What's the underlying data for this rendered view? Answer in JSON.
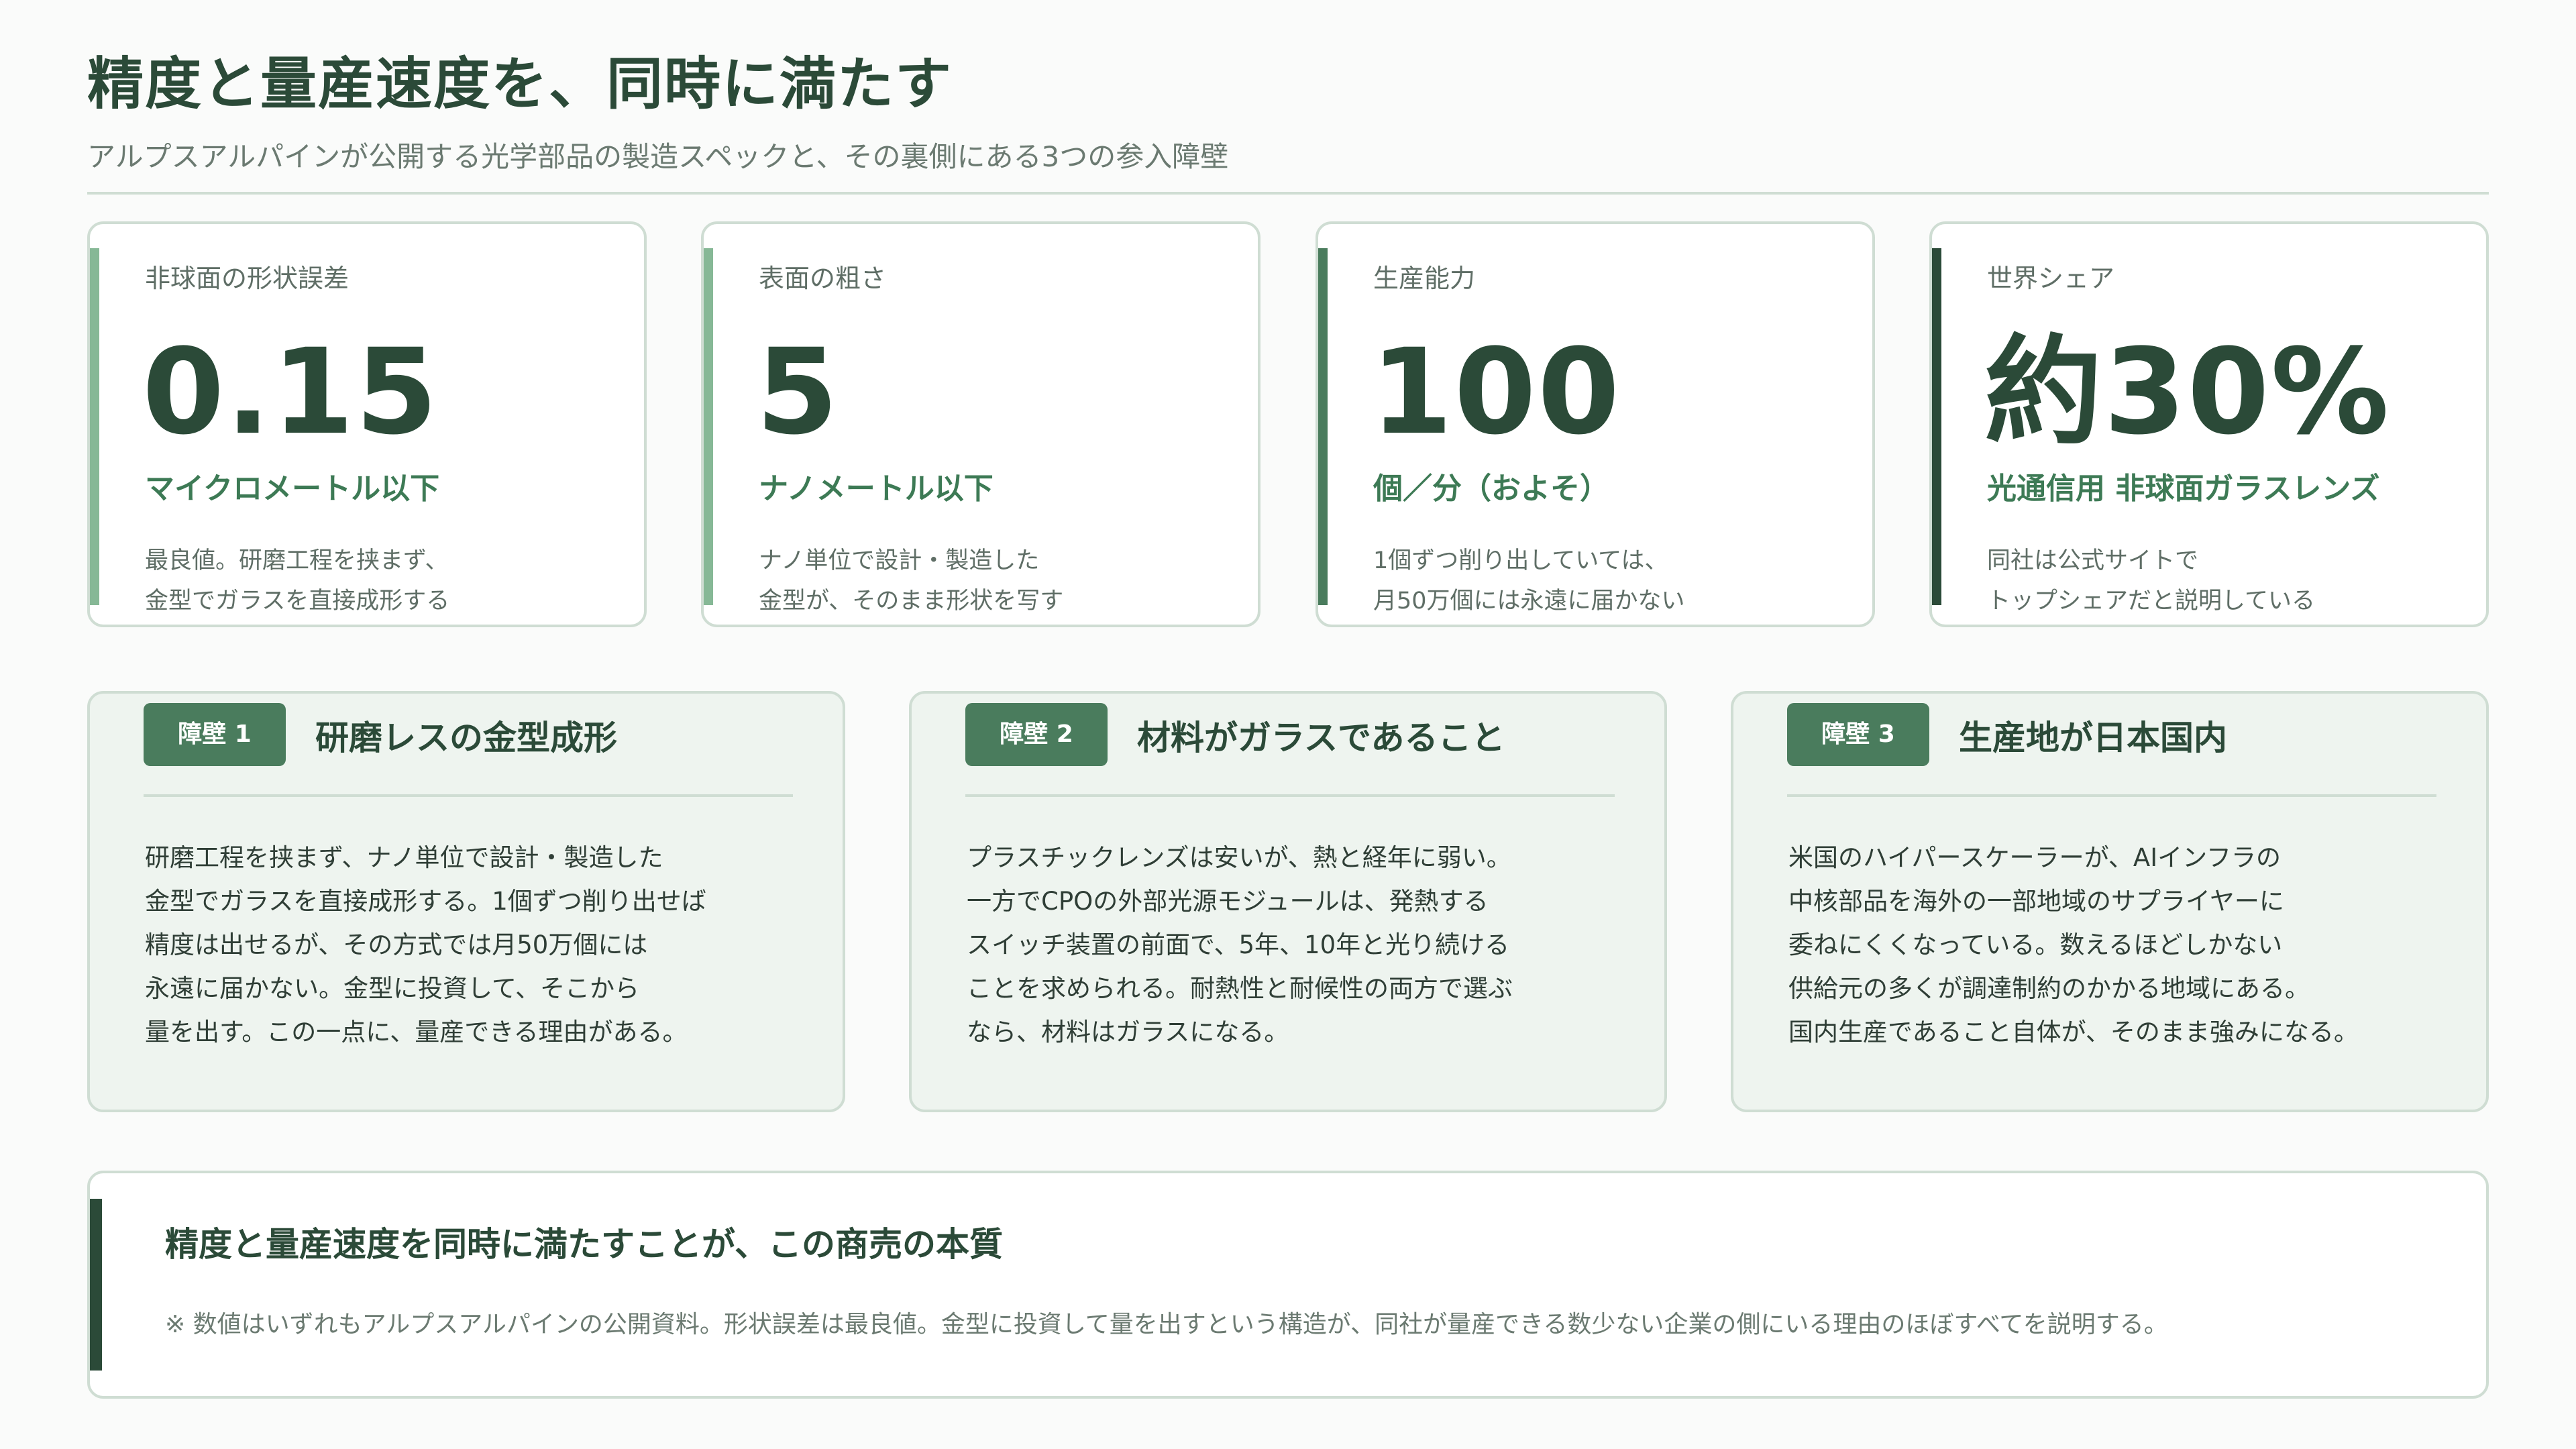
{
  "header": {
    "title": "精度と量産速度を、同時に満たす",
    "subtitle": "アルプスアルパインが公開する光学部品の製造スペックと、その裏側にある3つの参入障壁"
  },
  "colors": {
    "accent_light": "#86b896",
    "accent_mid": "#4a7c5d",
    "accent_dark": "#2b4a38"
  },
  "stats": [
    {
      "label": "非球面の形状誤差",
      "value": "0.15",
      "unit": "マイクロメートル以下",
      "note_line1": "最良値。研磨工程を挟まず、",
      "note_line2": "金型でガラスを直接成形する"
    },
    {
      "label": "表面の粗さ",
      "value": "5",
      "unit": "ナノメートル以下",
      "note_line1": "ナノ単位で設計・製造した",
      "note_line2": "金型が、そのまま形状を写す"
    },
    {
      "label": "生産能力",
      "value": "100",
      "unit": "個／分（およそ）",
      "note_line1": "1個ずつ削り出していては、",
      "note_line2": "月50万個には永遠に届かない"
    },
    {
      "label": "世界シェア",
      "value": "約30%",
      "unit": "光通信用 非球面ガラスレンズ",
      "note_line1": "同社は公式サイトで",
      "note_line2": "トップシェアだと説明している"
    }
  ],
  "barriers": [
    {
      "tag": "障壁 1",
      "title": "研磨レスの金型成形",
      "lines": [
        "研磨工程を挟まず、ナノ単位で設計・製造した",
        "金型でガラスを直接成形する。1個ずつ削り出せば",
        "精度は出せるが、その方式では月50万個には",
        "永遠に届かない。金型に投資して、そこから",
        "量を出す。この一点に、量産できる理由がある。"
      ]
    },
    {
      "tag": "障壁 2",
      "title": "材料がガラスであること",
      "lines": [
        "プラスチックレンズは安いが、熱と経年に弱い。",
        "一方でCPOの外部光源モジュールは、発熱する",
        "スイッチ装置の前面で、5年、10年と光り続ける",
        "ことを求められる。耐熱性と耐候性の両方で選ぶ",
        "なら、材料はガラスになる。"
      ]
    },
    {
      "tag": "障壁 3",
      "title": "生産地が日本国内",
      "lines": [
        "米国のハイパースケーラーが、AIインフラの",
        "中核部品を海外の一部地域のサプライヤーに",
        "委ねにくくなっている。数えるほどしかない",
        "供給元の多くが調達制約のかかる地域にある。",
        "国内生産であること自体が、そのまま強みになる。"
      ]
    }
  ],
  "summary": {
    "title": "精度と量産速度を同時に満たすことが、この商売の本質",
    "note": "※ 数値はいずれもアルプスアルパインの公開資料。形状誤差は最良値。金型に投資して量を出すという構造が、同社が量産できる数少ない企業の側にいる理由のほぼすべてを説明する。"
  }
}
